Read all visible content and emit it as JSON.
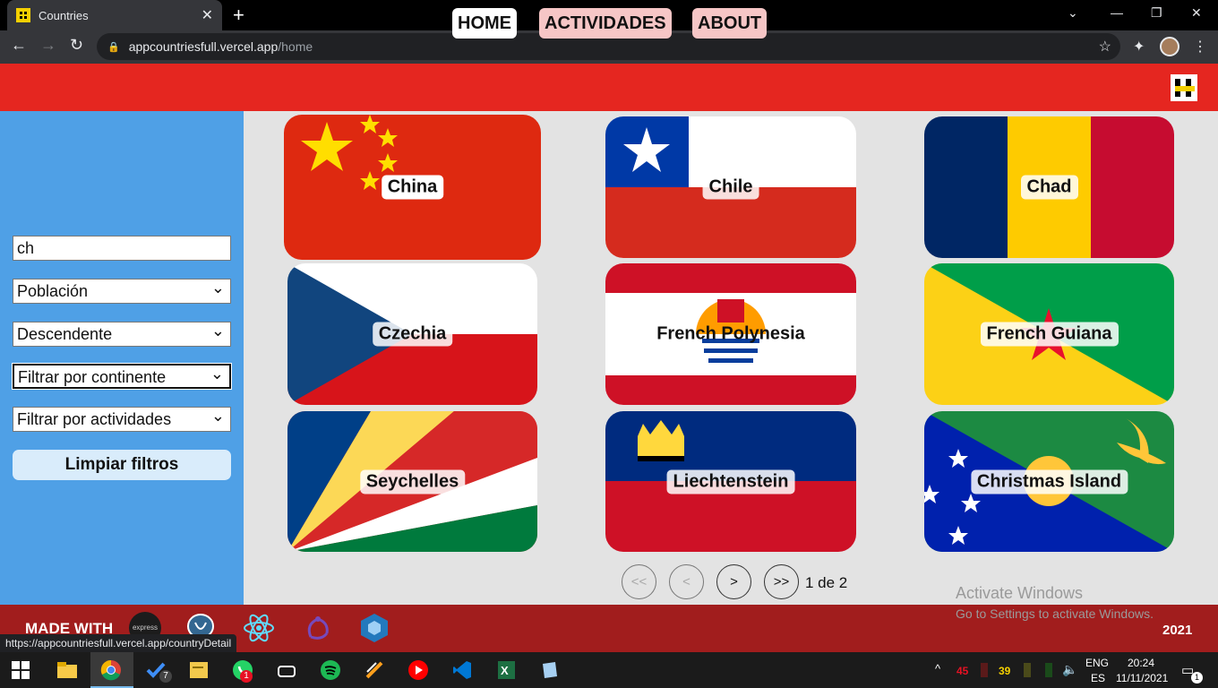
{
  "browser": {
    "tab_title": "Countries",
    "url_host": "appcountriesfull.vercel.app",
    "url_path": "/home",
    "status_url": "https://appcountriesfull.vercel.app/countryDetail"
  },
  "nav": {
    "home": "HOME",
    "activities": "ACTIVIDADES",
    "about": "ABOUT"
  },
  "filters": {
    "search_value": "ch",
    "sort_by": "Población",
    "order": "Descendente",
    "continent": "Filtrar por continente",
    "activities": "Filtrar por actividades",
    "clear_label": "Limpiar filtros"
  },
  "countries": [
    {
      "name": "China"
    },
    {
      "name": "Chile"
    },
    {
      "name": "Chad"
    },
    {
      "name": "Czechia"
    },
    {
      "name": "French Polynesia"
    },
    {
      "name": "French Guiana"
    },
    {
      "name": "Seychelles"
    },
    {
      "name": "Liechtenstein"
    },
    {
      "name": "Christmas Island"
    }
  ],
  "pagination": {
    "first": "<<",
    "prev": "<",
    "next": ">",
    "last": ">>",
    "indicator": "1 de 2"
  },
  "footer": {
    "made_with": "MADE WITH",
    "express_label": "express",
    "year": "2021"
  },
  "watermark": {
    "line1": "Activate Windows",
    "line2": "Go to Settings to activate Windows."
  },
  "taskbar": {
    "todo_badge": "7",
    "whatsapp_badge": "1",
    "cpu_temp": "45",
    "gpu_temp": "39",
    "lang_top": "ENG",
    "lang_bottom": "ES",
    "time": "20:24",
    "date": "11/11/2021",
    "notif_count": "1"
  },
  "colors": {
    "header_red": "#e52620",
    "sidebar_blue": "#4fa0e6",
    "footer_red": "#a11d1d"
  }
}
